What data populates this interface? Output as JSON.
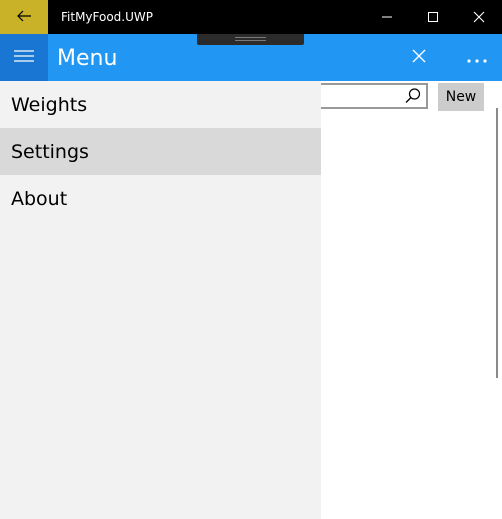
{
  "window": {
    "title": "FitMyFood.UWP",
    "accent_color": "#c9b227",
    "controls": [
      "minimize-icon",
      "maximize-icon",
      "close-icon"
    ]
  },
  "header": {
    "title": "Menu",
    "background_color": "#2196f3",
    "icons": [
      "hamburger-icon",
      "close-icon",
      "more-icon"
    ]
  },
  "nav": {
    "items": [
      {
        "label": "Weights",
        "selected": false
      },
      {
        "label": "Settings",
        "selected": true
      },
      {
        "label": "About",
        "selected": false
      }
    ]
  },
  "toolbar": {
    "search_placeholder": "",
    "search_icon": "search-icon",
    "new_label": "New"
  }
}
